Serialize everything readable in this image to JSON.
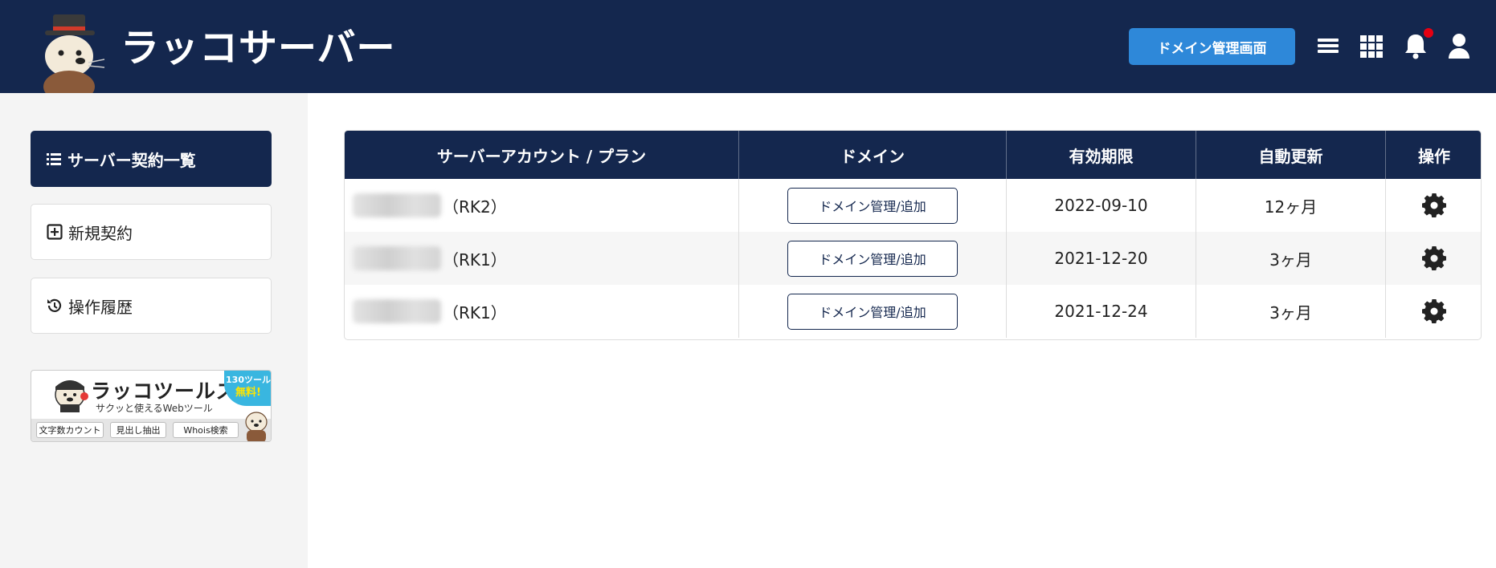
{
  "header": {
    "logo_text": "ラッコサーバー",
    "domain_button_label": "ドメイン管理画面",
    "icons": [
      "menu-icon",
      "apps-grid-icon",
      "bell-icon",
      "user-icon"
    ],
    "notification_dot_color": "#e60012",
    "bg_color": "#14274e",
    "accent_color": "#2e88d9"
  },
  "sidebar": {
    "items": [
      {
        "label": "サーバー契約一覧",
        "icon": "list-icon",
        "active": true
      },
      {
        "label": "新規契約",
        "icon": "plus-square-icon",
        "active": false
      },
      {
        "label": "操作履歴",
        "icon": "history-icon",
        "active": false
      }
    ],
    "banner": {
      "title": "ラッコツールズ",
      "subtitle": "サクッと使えるWebツール",
      "badge_line1": "130ツール",
      "badge_line2": "無料!",
      "pills": [
        "文字数カウント",
        "見出し抽出",
        "Whois検索"
      ]
    }
  },
  "table": {
    "headers": [
      "サーバーアカウント / プラン",
      "ドメイン",
      "有効期限",
      "自動更新",
      "操作"
    ],
    "rows": [
      {
        "plan": "（RK2）",
        "domain_button": "ドメイン管理/追加",
        "expiry": "2022-09-10",
        "auto_renew": "12ヶ月"
      },
      {
        "plan": "（RK1）",
        "domain_button": "ドメイン管理/追加",
        "expiry": "2021-12-20",
        "auto_renew": "3ヶ月"
      },
      {
        "plan": "（RK1）",
        "domain_button": "ドメイン管理/追加",
        "expiry": "2021-12-24",
        "auto_renew": "3ヶ月"
      }
    ]
  }
}
